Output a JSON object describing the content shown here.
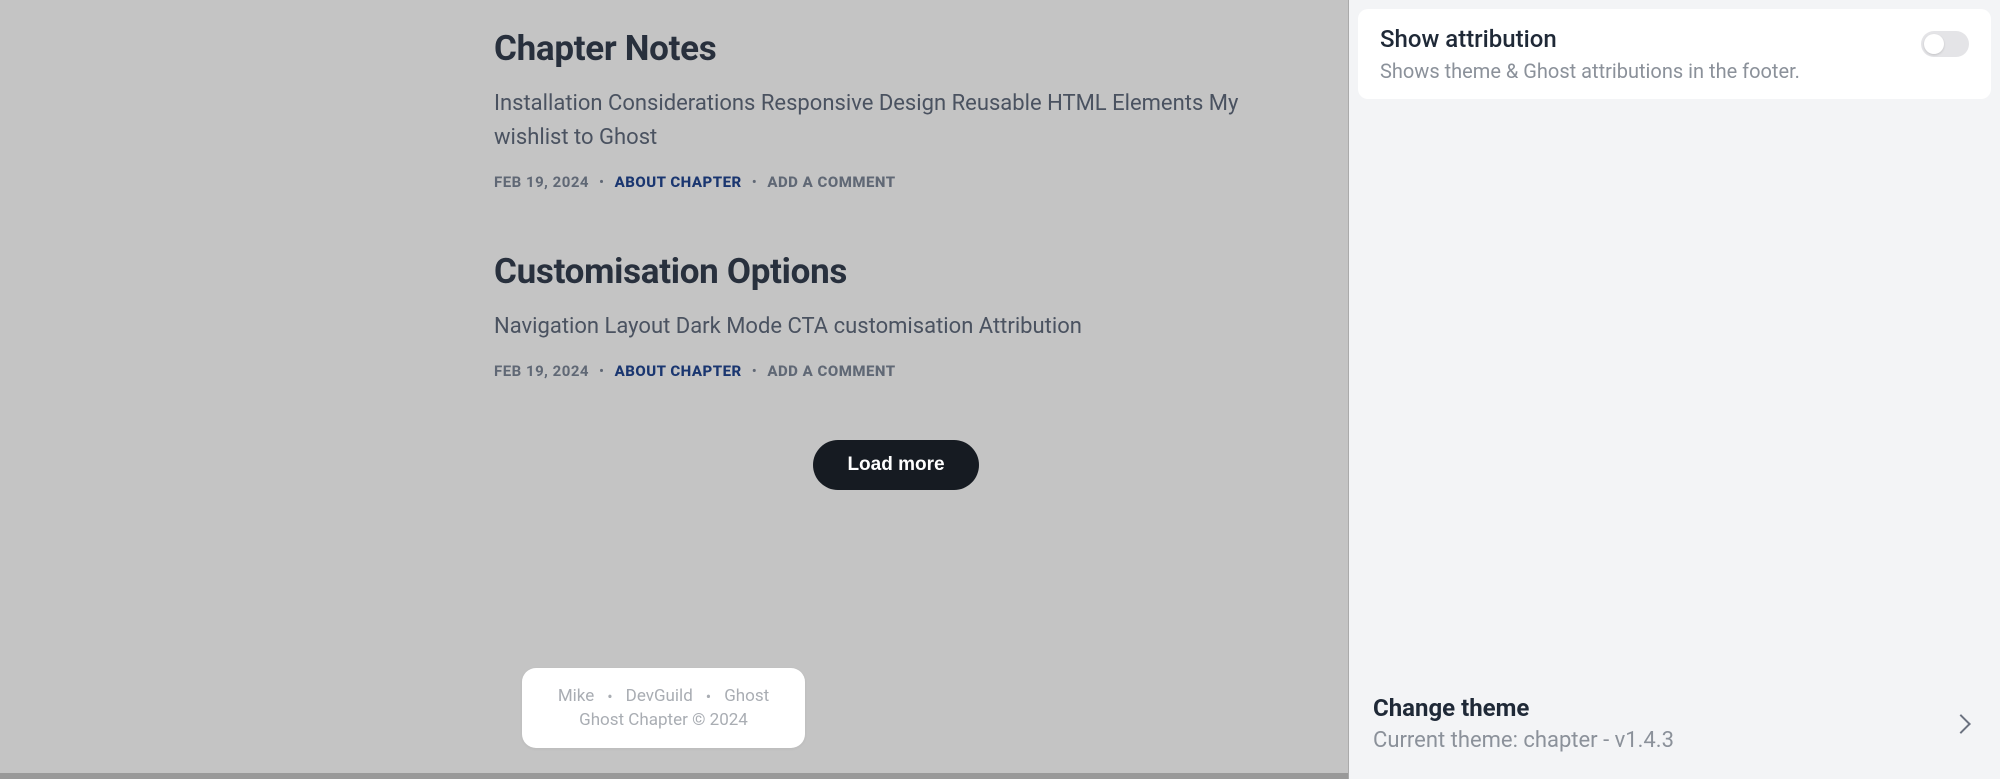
{
  "posts": [
    {
      "title": "Chapter Notes",
      "excerpt": "Installation Considerations Responsive Design Reusable HTML Elements My wishlist to Ghost",
      "date": "FEB 19, 2024",
      "tag": "ABOUT CHAPTER",
      "comment": "ADD A COMMENT"
    },
    {
      "title": "Customisation Options",
      "excerpt": "Navigation Layout Dark Mode CTA customisation Attribution",
      "date": "FEB 19, 2024",
      "tag": "ABOUT CHAPTER",
      "comment": "ADD A COMMENT"
    }
  ],
  "load_more_label": "Load more",
  "footer": {
    "link1": "Mike",
    "link2": "DevGuild",
    "link3": "Ghost",
    "copyright": "Ghost Chapter © 2024"
  },
  "sidebar": {
    "setting": {
      "title": "Show attribution",
      "desc": "Shows theme & Ghost attributions in the footer."
    },
    "change_theme": {
      "title": "Change theme",
      "sub": "Current theme: chapter - v1.4.3"
    }
  }
}
